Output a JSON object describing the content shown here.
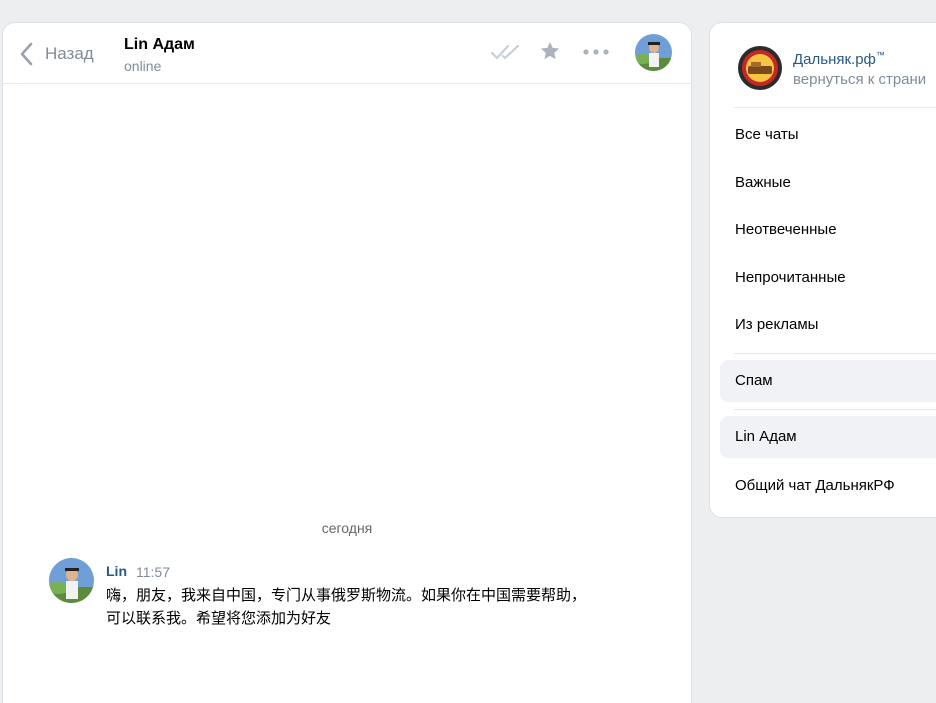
{
  "header": {
    "back_label": "Назад",
    "peer_name": "Lin Адам",
    "peer_status": "online"
  },
  "messages": {
    "date_separator": "сегодня",
    "items": [
      {
        "author": "Lin",
        "time": "11:57",
        "text": "嗨，朋友，我来自中国，专门从事俄罗斯物流。如果你在中国需要帮助，可以联系我。希望将您添加为好友"
      }
    ]
  },
  "sidebar": {
    "group_name": "Дальняк.рф",
    "group_name_mark": "™",
    "group_back": "вернуться к страни",
    "items": [
      {
        "label": "Все чаты"
      },
      {
        "label": "Важные"
      },
      {
        "label": "Неотвеченные"
      },
      {
        "label": "Непрочитанные"
      },
      {
        "label": "Из рекламы"
      },
      {
        "label": "Спам"
      },
      {
        "label": "Lin Адам"
      },
      {
        "label": "Общий чат ДальнякРФ"
      }
    ]
  },
  "colors": {
    "accent": "#2a5885",
    "muted": "#818c99",
    "background": "#edeef0"
  },
  "icons": [
    "chevron-left-icon",
    "double-check-icon",
    "star-icon",
    "more-icon"
  ]
}
